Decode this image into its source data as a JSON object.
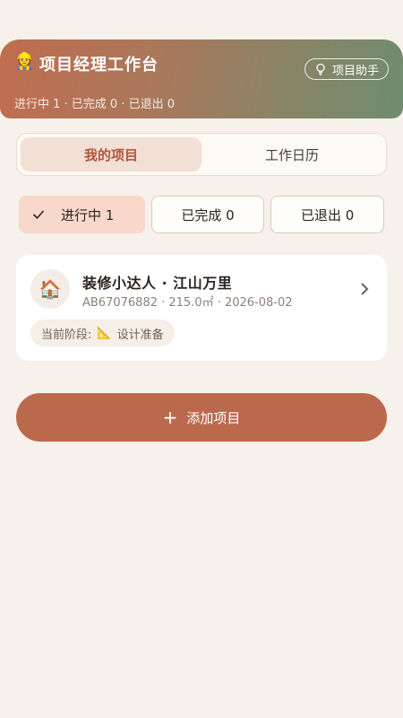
{
  "header": {
    "icon": "worker-emoji",
    "icon_glyph": "👷",
    "title": "项目经理工作台",
    "assistant_label": "项目助手",
    "stats": "进行中 1 · 已完成 0 · 已退出 0"
  },
  "tabs": [
    {
      "label": "我的项目",
      "active": true
    },
    {
      "label": "工作日历",
      "active": false
    }
  ],
  "filters": [
    {
      "label": "进行中 1",
      "active": true
    },
    {
      "label": "已完成 0",
      "active": false
    },
    {
      "label": "已退出 0",
      "active": false
    }
  ],
  "project": {
    "avatar_glyph": "🏠",
    "name": "装修小达人 · 江山万里",
    "meta": "AB67076882 · 215.0㎡ · 2026-08-02",
    "stage_label": "当前阶段:",
    "stage_icon_glyph": "📐",
    "stage_value": "设计准备"
  },
  "add_button": {
    "label": "添加项目",
    "icon_glyph": "+"
  },
  "colors": {
    "accent": "#bb694c",
    "background": "#f6f1ea",
    "tab_active_text": "#b0563a",
    "chip_active_bg": "#f8d8cb"
  }
}
